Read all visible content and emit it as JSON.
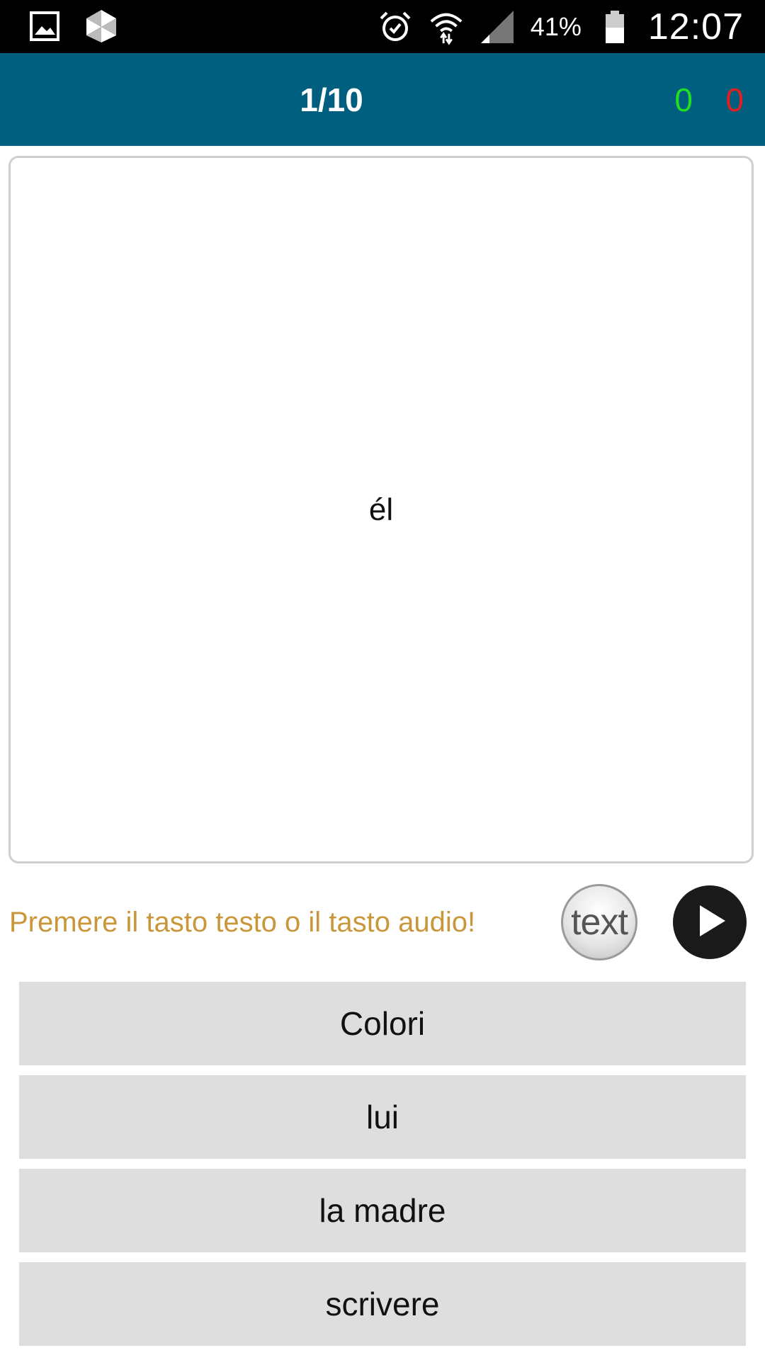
{
  "status_bar": {
    "battery_percent": "41%",
    "time": "12:07",
    "icons": [
      "gallery-icon",
      "dropbox-icon",
      "alarm-icon",
      "wifi-icon",
      "signal-icon",
      "battery-icon"
    ]
  },
  "header": {
    "progress": "1/10",
    "correct_count": "0",
    "wrong_count": "0",
    "colors": {
      "background": "#005f7f",
      "correct": "#22dd22",
      "wrong": "#e02020"
    }
  },
  "card": {
    "word": "él"
  },
  "hint": {
    "text": "Premere il tasto testo o il tasto audio!",
    "color": "#c9973a"
  },
  "buttons": {
    "text_label": "text",
    "play_icon": "play-icon"
  },
  "options": [
    {
      "label": "Colori"
    },
    {
      "label": "lui"
    },
    {
      "label": "la madre"
    },
    {
      "label": "scrivere"
    }
  ]
}
